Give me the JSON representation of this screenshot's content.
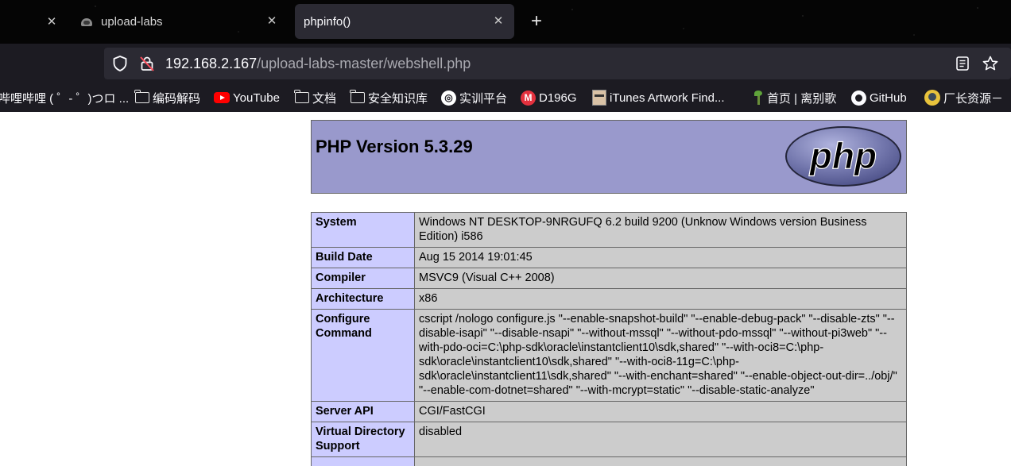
{
  "browser": {
    "tabs": [
      {
        "title": "upload-labs",
        "active": false
      },
      {
        "title": "phpinfo()",
        "active": true
      }
    ],
    "new_tab_label": "+",
    "close_glyph": "✕",
    "url": {
      "host": "192.168.2.167",
      "path": "/upload-labs-master/webshell.php"
    },
    "bookmarks": [
      {
        "label": "哔哩哔哩 ( ゜- ゜)つロ ...",
        "icon": "none"
      },
      {
        "label": "编码解码",
        "icon": "folder-icon"
      },
      {
        "label": "YouTube",
        "icon": "youtube-icon"
      },
      {
        "label": "文档",
        "icon": "folder-icon"
      },
      {
        "label": "安全知识库",
        "icon": "folder-icon"
      },
      {
        "label": "实训平台",
        "icon": "platform-icon"
      },
      {
        "label": "D196G",
        "icon": "m-icon"
      },
      {
        "label": "iTunes Artwork Find...",
        "icon": "face-icon"
      },
      {
        "label": "首页 | 离别歌",
        "icon": "plant-icon"
      },
      {
        "label": "GitHub",
        "icon": "github-icon"
      },
      {
        "label": "厂长资源－",
        "icon": "site-icon"
      }
    ]
  },
  "phpinfo": {
    "version_title": "PHP Version 5.3.29",
    "logo_text": "php",
    "rows": [
      {
        "key": "System",
        "value": "Windows NT DESKTOP-9NRGUFQ 6.2 build 9200 (Unknow Windows version Business Edition) i586"
      },
      {
        "key": "Build Date",
        "value": "Aug 15 2014 19:01:45"
      },
      {
        "key": "Compiler",
        "value": "MSVC9 (Visual C++ 2008)"
      },
      {
        "key": "Architecture",
        "value": "x86"
      },
      {
        "key": "Configure Command",
        "value": "cscript /nologo configure.js \"--enable-snapshot-build\" \"--enable-debug-pack\" \"--disable-zts\" \"--disable-isapi\" \"--disable-nsapi\" \"--without-mssql\" \"--without-pdo-mssql\" \"--without-pi3web\" \"--with-pdo-oci=C:\\php-sdk\\oracle\\instantclient10\\sdk,shared\" \"--with-oci8=C:\\php-sdk\\oracle\\instantclient10\\sdk,shared\" \"--with-oci8-11g=C:\\php-sdk\\oracle\\instantclient11\\sdk,shared\" \"--with-enchant=shared\" \"--enable-object-out-dir=../obj/\" \"--enable-com-dotnet=shared\" \"--with-mcrypt=static\" \"--disable-static-analyze\""
      },
      {
        "key": "Server API",
        "value": "CGI/FastCGI"
      },
      {
        "key": "Virtual Directory Support",
        "value": "disabled"
      },
      {
        "key": "",
        "value": ""
      }
    ]
  },
  "colors": {
    "chrome_bg": "#1c1b22",
    "tab_active_bg": "#2b2a33",
    "php_header_bg": "#9999cc",
    "key_cell_bg": "#ccccff",
    "value_cell_bg": "#cccccc"
  }
}
